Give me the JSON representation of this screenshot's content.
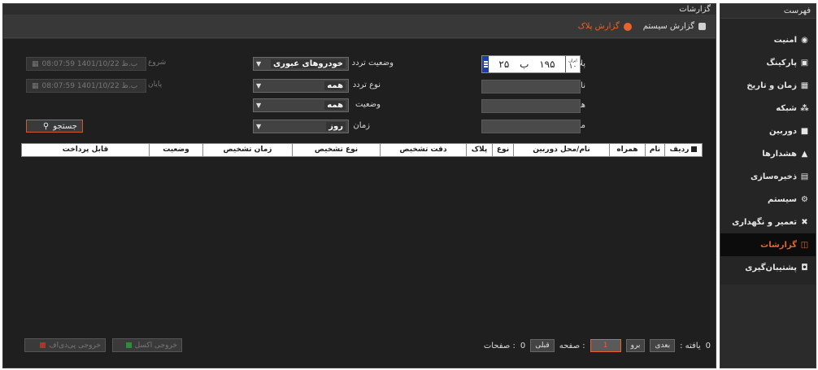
{
  "window_title": "گزارشات",
  "sidebar": {
    "title": "فهرست",
    "items": [
      {
        "label": "امنیت",
        "icon": "shield-icon"
      },
      {
        "label": "پارکینگ",
        "icon": "parking-icon"
      },
      {
        "label": "زمان و تاریخ",
        "icon": "calendar-icon"
      },
      {
        "label": "شبکه",
        "icon": "network-icon"
      },
      {
        "label": "دوربین",
        "icon": "camera-icon"
      },
      {
        "label": "هشدارها",
        "icon": "bell-icon"
      },
      {
        "label": "ذخیره‌سازی",
        "icon": "storage-icon"
      },
      {
        "label": "سیستم",
        "icon": "gears-icon"
      },
      {
        "label": "تعمیر و نگهداری",
        "icon": "tools-icon"
      },
      {
        "label": "گزارشات",
        "icon": "report-icon",
        "active": true
      },
      {
        "label": "پشتیبان‌گیری",
        "icon": "backup-icon"
      }
    ]
  },
  "tabs": [
    {
      "label": "گزارش سیستم",
      "icon": "lock-icon"
    },
    {
      "label": "گزارش پلاک",
      "icon": "plate-report-icon",
      "active": true
    }
  ],
  "form": {
    "plate_label": "پلاک",
    "plate": {
      "part1": "۲۵",
      "letter": "ب",
      "part2": "۱۹۵",
      "region_caption": "ایران",
      "region": "۱۰"
    },
    "name_label": "نام",
    "companion_label": "همراه",
    "model_label": "مدل",
    "traffic_status_label": "وضعیت تردد",
    "traffic_status_value": "خودروهای عبوری",
    "traffic_type_label": "نوع تردد",
    "traffic_type_value": "همه",
    "status_label": "وضعیت",
    "status_value": "همه",
    "time_label": "زمان",
    "time_value": "روز",
    "start_label": "شروع",
    "start_value": "ب.ظ 1401/10/22 08:07:59",
    "end_label": "پایان",
    "end_value": "ب.ظ 1401/10/22 08:07:59",
    "search_label": "جستجو"
  },
  "table": {
    "columns": [
      "ردیف",
      "نام",
      "همراه",
      "نام/محل دوربین",
      "نوع",
      "پلاک",
      "دقت تشخیص",
      "نوع تشخیص",
      "زمان تشخیص",
      "وضعیت",
      "قابل پرداخت"
    ]
  },
  "footer": {
    "found_label": "یافته :",
    "found_count": "0",
    "next_label": "بعدی",
    "go_label": "برو",
    "page_input": "1",
    "page_label": ": صفحه",
    "prev_label": "قبلی",
    "pages_count": "0",
    "pages_label": ": صفحات",
    "excel_label": "خروجی اکسل",
    "pdf_label": "خروجی پی‌دی‌اف"
  },
  "colors": {
    "accent": "#e7642a",
    "panel": "#1f1f1f",
    "sidebar": "#252525"
  }
}
